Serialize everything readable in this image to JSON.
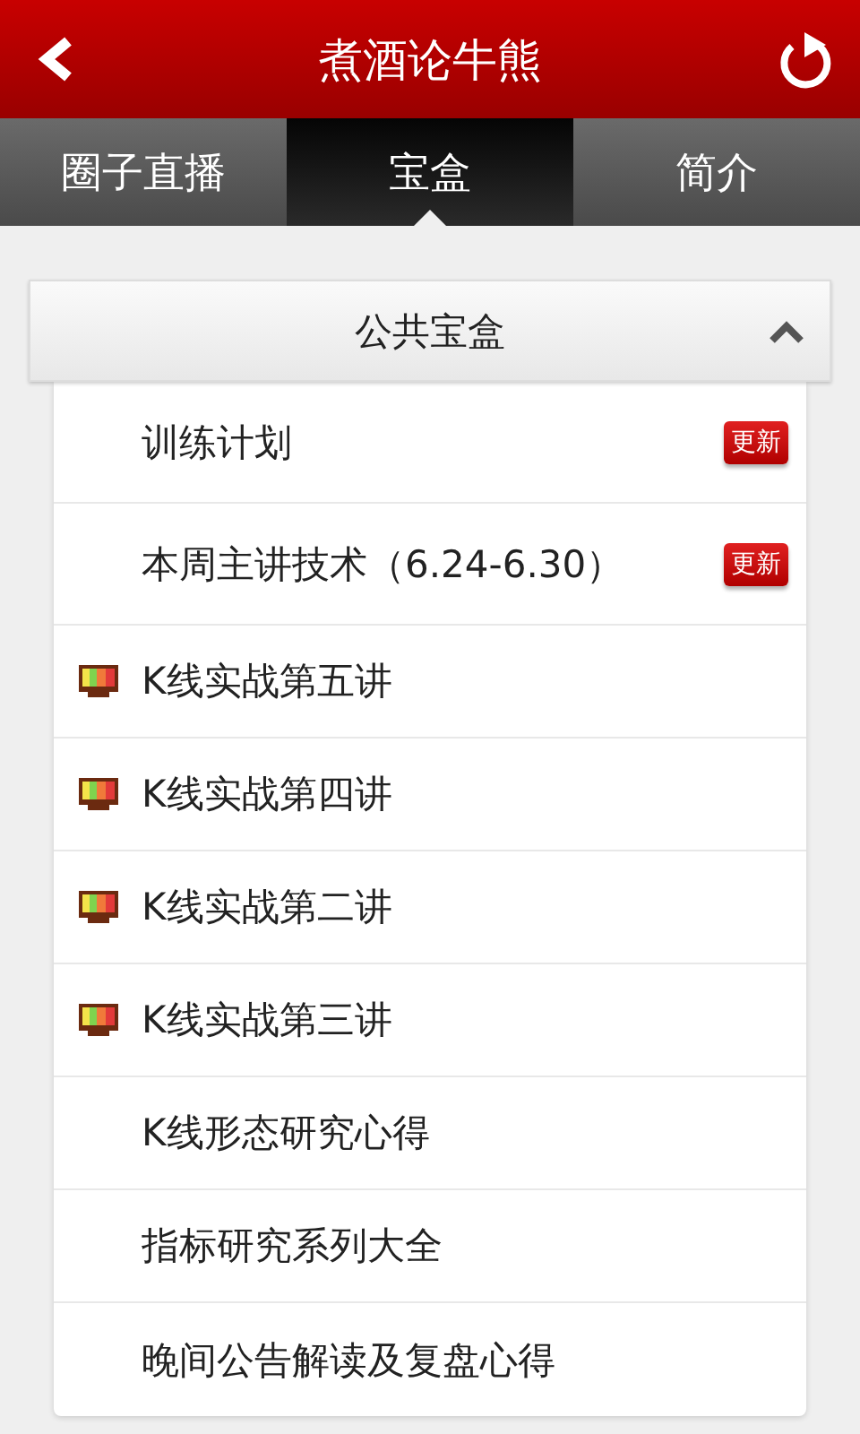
{
  "header": {
    "title": "煮酒论牛熊"
  },
  "tabs": [
    {
      "label": "圈子直播",
      "selected": false
    },
    {
      "label": "宝盒",
      "selected": true
    },
    {
      "label": "简介",
      "selected": false
    }
  ],
  "section": {
    "title": "公共宝盒",
    "expanded": true,
    "items": [
      {
        "kind": "text",
        "label": "训练计划",
        "badge": "更新"
      },
      {
        "kind": "text",
        "label": "本周主讲技术（6.24-6.30）",
        "badge": "更新"
      },
      {
        "kind": "video",
        "label": "K线实战第五讲"
      },
      {
        "kind": "video",
        "label": "K线实战第四讲"
      },
      {
        "kind": "video",
        "label": "K线实战第二讲"
      },
      {
        "kind": "video",
        "label": "K线实战第三讲"
      },
      {
        "kind": "text",
        "label": "K线形态研究心得"
      },
      {
        "kind": "text",
        "label": "指标研究系列大全"
      },
      {
        "kind": "text",
        "label": "晚间公告解读及复盘心得"
      }
    ]
  }
}
